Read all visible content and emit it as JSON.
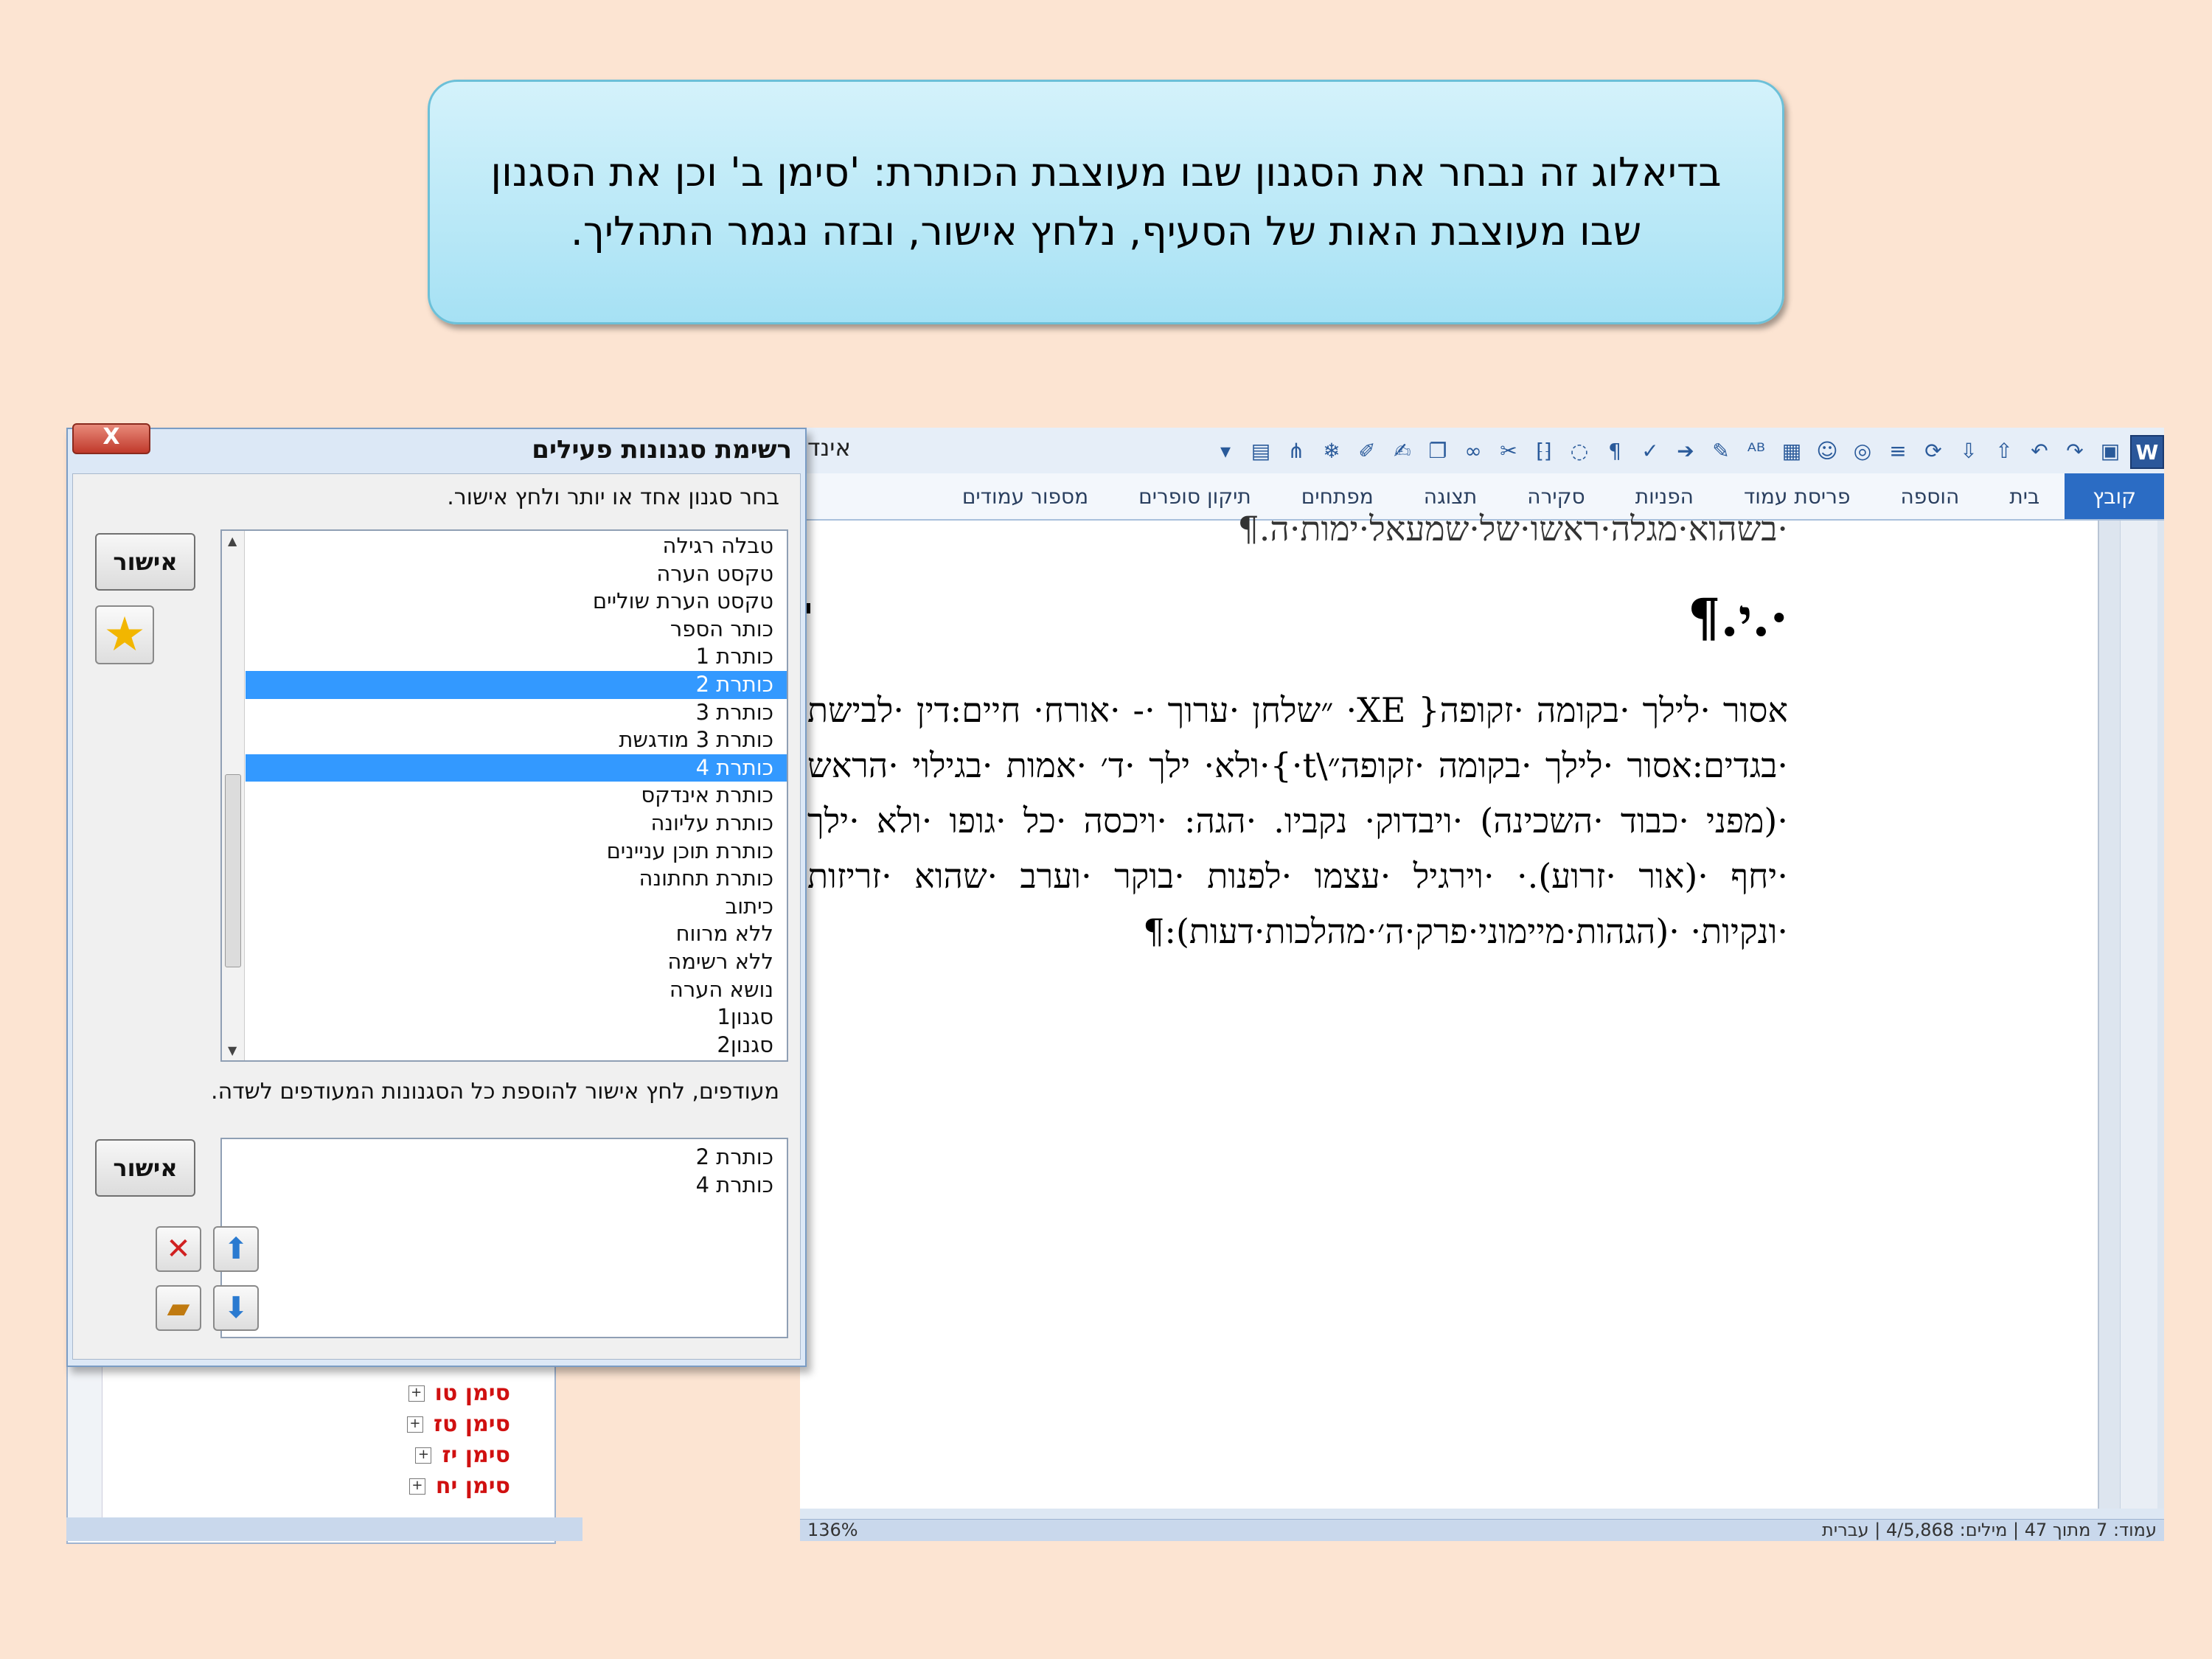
{
  "callout": {
    "text": "בדיאלוג זה נבחר את הסגנון שבו מעוצבת הכותרת: 'סימן ב' וכן את הסגנון שבו מעוצבת האות של הסעיף, נלחץ אישור, ובזה נגמר התהליך."
  },
  "word": {
    "qat_title": "אינד",
    "ribbon_tabs": [
      "קובץ",
      "בית",
      "הוספה",
      "פריסת עמוד",
      "הפניות",
      "סקירה",
      "תצוגה",
      "מפתחים",
      "תיקון סופרים",
      "מספור עמודים"
    ],
    "document": {
      "top_line": "·בשהוא·מגלה·ראשו·של·שמעאל·ימות·ה.¶",
      "heading": "·.י.¶",
      "paragraph": "אסור ·לילך ·בקומה ·זקופה{ XE· ״שלחן ·ערוך ·- ·אורח· חיים:דין ·לבישת ·בגדים:אסור ·לילך ·בקומה ·זקופה״\\t·}·ולא· ילך ·ד׳ ·אמות ·בגילוי ·הראש ·(מפני ·כבוד ·השכינה) ·ויבדוק· נקביו. ·הגה: ·ויכסה ·כל ·גופו ·ולא ·ילך ·יחף ·(אור ·זרוע).· ·וירגיל ·עצמו ·לפנות ·בוקר ·וערב ·שהוא ·זריזות ·ונקיות· ·(הגהות·מיימוני·פרק·ה׳·מהלכות·דעות):¶"
    },
    "status_left": "136%",
    "status_right": "עמוד: 7 מתוך 47 | מילים: 4/5,868 | עברית"
  },
  "nav_pane": {
    "items": [
      "סימן טו",
      "סימן טז",
      "סימן יז",
      "סימן יח"
    ]
  },
  "dialog": {
    "title": "רשימת סגנונות פעילים",
    "close_label": "X",
    "instruction_top": "בחר סגנון אחד או יותר ולחץ אישור.",
    "styles": [
      {
        "label": "טבלה רגילה",
        "selected": false
      },
      {
        "label": "טקסט הערה",
        "selected": false
      },
      {
        "label": "טקסט הערת שוליים",
        "selected": false
      },
      {
        "label": "כותר הספר",
        "selected": false
      },
      {
        "label": "כותרת 1",
        "selected": false
      },
      {
        "label": "כותרת 2",
        "selected": true
      },
      {
        "label": "כותרת 3",
        "selected": false
      },
      {
        "label": "כותרת 3 מודגשת",
        "selected": false
      },
      {
        "label": "כותרת 4",
        "selected": true
      },
      {
        "label": "כותרת אינדקס",
        "selected": false
      },
      {
        "label": "כותרת עליונה",
        "selected": false
      },
      {
        "label": "כותרת תוכן עניינים",
        "selected": false
      },
      {
        "label": "כותרת תחתונה",
        "selected": false
      },
      {
        "label": "כיתוב",
        "selected": false
      },
      {
        "label": "ללא מרווח",
        "selected": false
      },
      {
        "label": "ללא רשימה",
        "selected": false
      },
      {
        "label": "נושא הערה",
        "selected": false
      },
      {
        "label": "סגנון1",
        "selected": false
      },
      {
        "label": "סגנון2",
        "selected": false
      }
    ],
    "ok_label": "אישור",
    "instruction_bottom": "מעודפים, לחץ אישור להוספת כל הסגנונות המעודפים לשדה.",
    "favorites": [
      "כותרת 2",
      "כותרת 4"
    ],
    "ok2_label": "אישור",
    "colors": {
      "selection": "#3399ff",
      "brand": "#2b579a"
    }
  }
}
